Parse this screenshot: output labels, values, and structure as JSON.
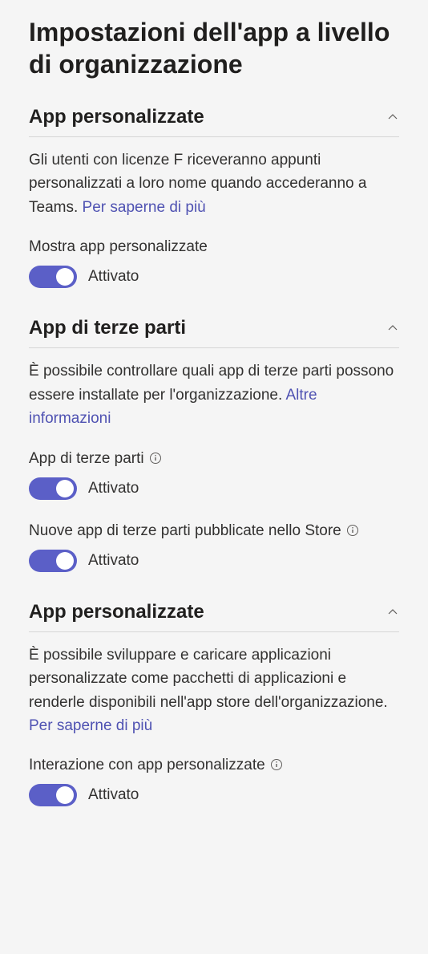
{
  "page": {
    "title": "Impostazioni dell'app a livello di organizzazione"
  },
  "sections": {
    "tailored": {
      "title": "App personalizzate",
      "desc_prefix": "Gli utenti con licenze F riceveranno appunti personalizzati a loro nome quando accederanno a Teams. ",
      "desc_link": "Per saperne di più",
      "field1_label": "Mostra app personalizzate",
      "field1_state": "Attivato"
    },
    "thirdparty": {
      "title": "App di terze parti",
      "desc_prefix": "È possibile controllare quali app di terze parti possono essere installate per l'organizzazione. ",
      "desc_link": "Altre informazioni",
      "field1_label": "App di terze parti",
      "field1_state": "Attivato",
      "field2_label": "Nuove app di terze parti pubblicate nello Store",
      "field2_state": "Attivato"
    },
    "custom": {
      "title": "App personalizzate",
      "desc_prefix": "È possibile sviluppare e caricare applicazioni personalizzate come pacchetti di applicazioni e renderle disponibili nell'app store dell'organizzazione. ",
      "desc_link": "Per saperne di più",
      "field1_label": "Interazione con app personalizzate",
      "field1_state": "Attivato"
    }
  }
}
